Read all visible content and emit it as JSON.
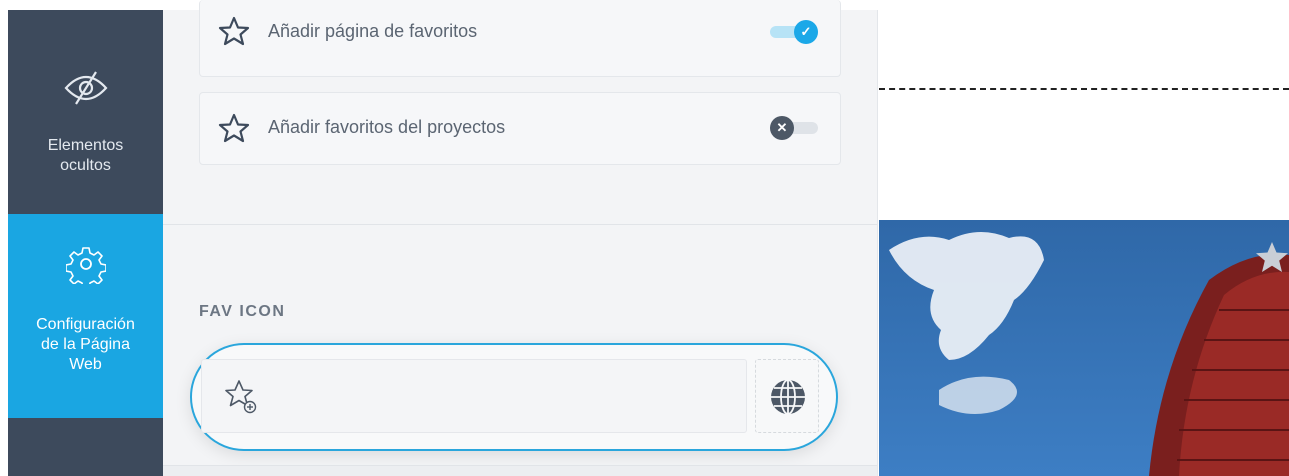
{
  "sidebar": {
    "items": [
      {
        "label_line1": "Elementos",
        "label_line2": "ocultos",
        "icon": "eye-slash-icon",
        "active": false
      },
      {
        "label_line1": "Configuración",
        "label_line2": "de la Página",
        "label_line3": "Web",
        "icon": "gear-icon",
        "active": true
      }
    ]
  },
  "panel": {
    "favorites": [
      {
        "label": "Añadir página de favoritos",
        "icon": "star-outline-icon",
        "enabled": true
      },
      {
        "label": "Añadir favoritos del proyectos",
        "icon": "star-outline-icon",
        "enabled": false
      }
    ],
    "favicon": {
      "title": "FAV ICON",
      "input_icon": "star-add-icon",
      "button_icon": "globe-icon"
    }
  },
  "colors": {
    "sidebar_bg": "#3d4a5c",
    "accent": "#1aa6e2",
    "panel_bg": "#f3f4f6"
  }
}
